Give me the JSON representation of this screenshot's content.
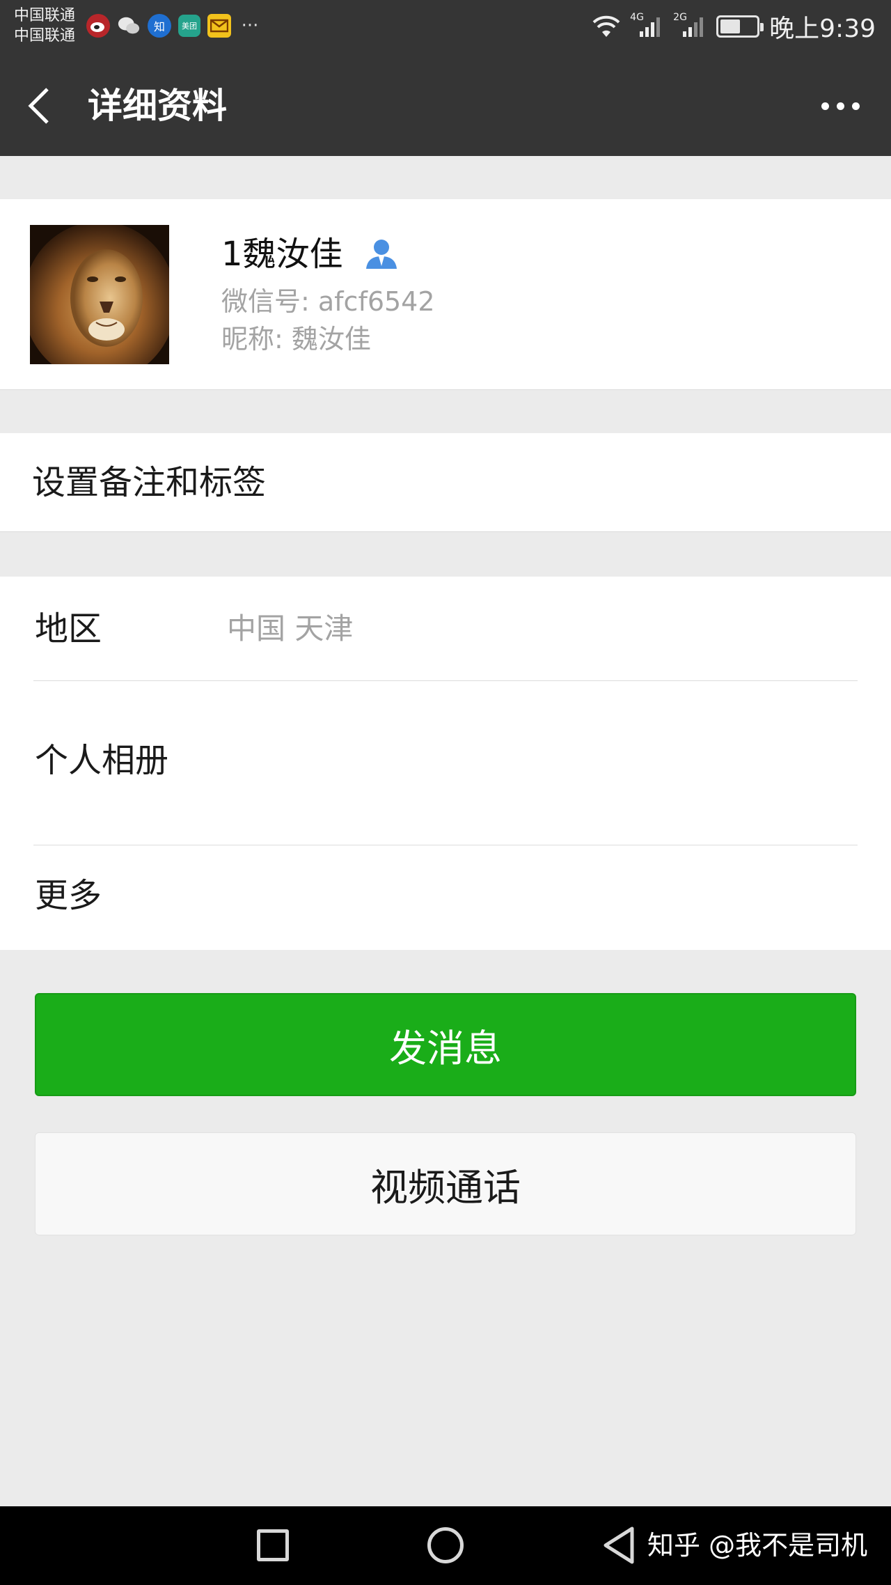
{
  "status_bar": {
    "carrier_1": "中国联通",
    "carrier_2": "中国联通",
    "notification_icons": [
      "weibo-icon",
      "wechat-icon",
      "zhihu-icon",
      "meituan-icon",
      "mail-icon"
    ],
    "zhihu_glyph": "知",
    "meituan_glyph": "美团",
    "more_glyph": "···",
    "network_1": "4G",
    "network_2": "2G",
    "time": "晚上9:39",
    "battery_level": 0.55
  },
  "header": {
    "title": "详细资料"
  },
  "profile": {
    "display_name": "1魏汝佳",
    "wechat_id": "微信号: afcf6542",
    "nickname": "昵称: 魏汝佳"
  },
  "remark": {
    "label": "设置备注和标签"
  },
  "info": {
    "region_label": "地区",
    "region_value": "中国  天津",
    "album_label": "个人相册",
    "more_label": "更多"
  },
  "actions": {
    "send_message": "发消息",
    "video_call": "视频通话"
  },
  "nav_bar": {
    "watermark": "知乎 @我不是司机"
  },
  "colors": {
    "header_bg": "#353535",
    "page_bg": "#ebebeb",
    "primary_green": "#1aad19",
    "secondary_text": "#a3a3a3"
  }
}
